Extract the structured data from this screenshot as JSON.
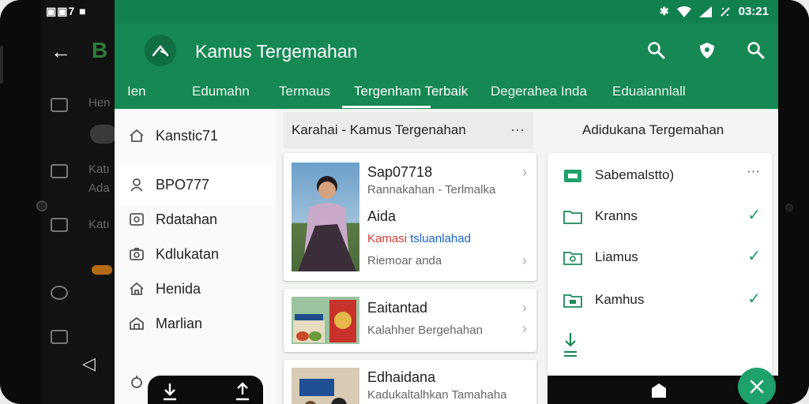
{
  "background_app": {
    "status_text": "▣▣7 ■",
    "logo_text": "B",
    "items": [
      "Hen",
      "Katı",
      "Ada",
      "Katı"
    ]
  },
  "statusbar": {
    "time": "03:21",
    "icons": [
      "bluetooth-icon",
      "wifi-icon",
      "signal-icon",
      "battery-icon"
    ]
  },
  "toolbar": {
    "title": "Kamus Tergemahan",
    "tabs": [
      "Ien",
      "Edumahn",
      "Termaus",
      "Tergenham Terbaik",
      "Degerahea Inda",
      "Eduaiannlall"
    ],
    "active_tab_index": 3
  },
  "drawer": {
    "items": [
      {
        "label": "Kanstic71",
        "icon": "home-icon"
      },
      {
        "label": "BPO777",
        "icon": "user-icon",
        "active": true
      },
      {
        "label": "Rdatahan",
        "icon": "image-icon"
      },
      {
        "label": "Kdlukatan",
        "icon": "camera-icon"
      },
      {
        "label": "Henida",
        "icon": "house-icon"
      },
      {
        "label": "Marlian",
        "icon": "store-icon"
      }
    ]
  },
  "middle": {
    "header_title": "Karahai - Kamus Tergenahan",
    "more": "⋯",
    "cards": [
      {
        "title": "Sap07718",
        "subtitle": "Rannakahan - Terlmalka",
        "line3": "Aida",
        "highlight_red": "Kamasi",
        "highlight_blue": "tsluanlahad",
        "footer": "Riemoar anda"
      },
      {
        "title": "Eaitantad",
        "subtitle": "Kalahher Bergehahan"
      },
      {
        "title": "Edhaidana",
        "subtitle": "Kadukaltalhkan Tamahaha"
      }
    ]
  },
  "right": {
    "header_title": "Adidukana Tergemahan",
    "items": [
      {
        "label": "Sabemalstto)",
        "icon": "folder-icon",
        "trailing": "more"
      },
      {
        "label": "Kranns",
        "icon": "folder-icon",
        "trailing": "check"
      },
      {
        "label": "Liamus",
        "icon": "folder-sync-icon",
        "trailing": "check"
      },
      {
        "label": "Kamhus",
        "icon": "folder-icon",
        "trailing": "check"
      }
    ],
    "more": "⋯",
    "check": "✓"
  },
  "colors": {
    "primary": "#168853",
    "primary_dark": "#128150",
    "accent": "#1ea16b",
    "text": "#222222",
    "red": "#d93a32",
    "blue": "#1a63c7"
  }
}
